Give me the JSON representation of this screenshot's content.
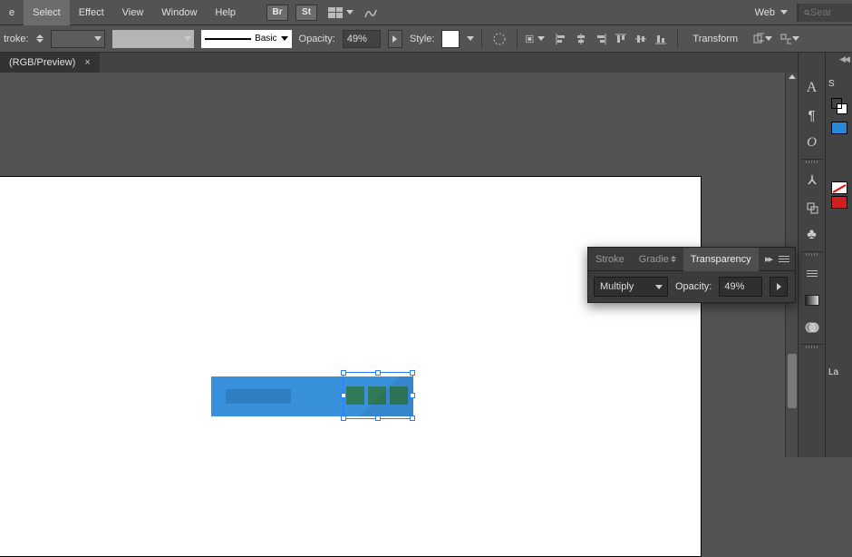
{
  "menu": {
    "items": [
      "e",
      "Select",
      "Effect",
      "View",
      "Window",
      "Help"
    ],
    "selected_index": 1,
    "bridge_label": "Br",
    "stock_label": "St",
    "workspace_label": "Web",
    "search_placeholder": "Sear"
  },
  "control": {
    "stroke_label": "troke:",
    "brush_label": "Basic",
    "opacity_label": "Opacity:",
    "opacity_value": "49%",
    "style_label": "Style:",
    "transform_label": "Transform"
  },
  "doc": {
    "tab_title": "(RGB/Preview)"
  },
  "panel": {
    "tabs": [
      "Stroke",
      "Gradie",
      "Transparency"
    ],
    "active_tab": 2,
    "blend_mode": "Multiply",
    "opacity_label": "Opacity:",
    "opacity_value": "49%"
  },
  "dock": {
    "right_labels": [
      "S",
      "La"
    ]
  },
  "colors": {
    "swatch_blue": "#2a89d6",
    "swatch_red": "#d11f1f"
  }
}
